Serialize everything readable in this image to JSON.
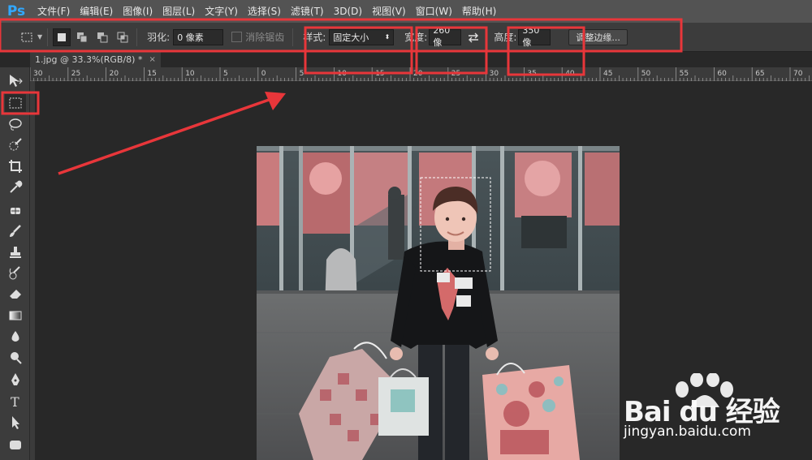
{
  "app": {
    "logo": "Ps"
  },
  "menu": [
    "文件(F)",
    "编辑(E)",
    "图像(I)",
    "图层(L)",
    "文字(Y)",
    "选择(S)",
    "滤镜(T)",
    "3D(D)",
    "视图(V)",
    "窗口(W)",
    "帮助(H)"
  ],
  "options": {
    "feather_label": "羽化:",
    "feather_value": "0 像素",
    "antialias_label": "消除锯齿",
    "style_label": "样式:",
    "style_value": "固定大小",
    "width_label": "宽度:",
    "width_value": "260 像",
    "height_label": "高度:",
    "height_value": "350 像",
    "refine_button": "调整边缘..."
  },
  "document": {
    "tab_title": "1.jpg @ 33.3%(RGB/8) *",
    "tab_close": "×"
  },
  "ruler": {
    "labels": [
      "30",
      "25",
      "20",
      "15",
      "10",
      "5",
      "0",
      "5",
      "10",
      "15",
      "20",
      "25",
      "30",
      "35",
      "40",
      "45",
      "50",
      "55",
      "60",
      "65",
      "70"
    ]
  },
  "tools": [
    {
      "name": "move-tool-icon"
    },
    {
      "name": "rect-marquee-tool-icon",
      "active": true
    },
    {
      "name": "lasso-tool-icon"
    },
    {
      "name": "quick-select-tool-icon"
    },
    {
      "name": "crop-tool-icon"
    },
    {
      "name": "eyedropper-tool-icon"
    },
    {
      "name": "healing-brush-tool-icon"
    },
    {
      "name": "brush-tool-icon"
    },
    {
      "name": "clone-stamp-tool-icon"
    },
    {
      "name": "history-brush-tool-icon"
    },
    {
      "name": "eraser-tool-icon"
    },
    {
      "name": "gradient-tool-icon"
    },
    {
      "name": "blur-tool-icon"
    },
    {
      "name": "dodge-tool-icon"
    },
    {
      "name": "pen-tool-icon"
    },
    {
      "name": "type-tool-icon"
    },
    {
      "name": "path-select-tool-icon"
    },
    {
      "name": "shape-tool-icon"
    }
  ],
  "annotation_color": "#e8363a",
  "watermark": {
    "brand": "Bai du 经验",
    "url": "jingyan.baidu.com"
  }
}
